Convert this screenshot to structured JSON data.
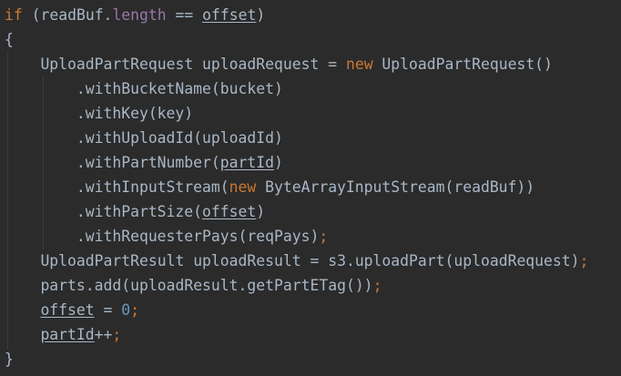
{
  "editor": {
    "language": "java",
    "theme_colors": {
      "background": "#2b2b2b",
      "default_text": "#a9b7c6",
      "keyword": "#cc7832",
      "number": "#6897bb",
      "field": "#9876aa",
      "indent_guide": "#3b3b3b"
    },
    "lines": [
      {
        "indent": 0,
        "tokens": [
          {
            "t": "if",
            "c": "kw"
          },
          {
            "t": " (readBuf."
          },
          {
            "t": "length",
            "c": "field"
          },
          {
            "t": " == "
          },
          {
            "t": "offset",
            "c": "ul"
          },
          {
            "t": ")"
          }
        ]
      },
      {
        "indent": 0,
        "tokens": [
          {
            "t": "{"
          }
        ]
      },
      {
        "indent": 4,
        "tokens": [
          {
            "t": "UploadPartRequest uploadRequest = "
          },
          {
            "t": "new",
            "c": "kw"
          },
          {
            "t": " UploadPartRequest()"
          }
        ]
      },
      {
        "indent": 8,
        "tokens": [
          {
            "t": ".withBucketName(bucket)"
          }
        ]
      },
      {
        "indent": 8,
        "tokens": [
          {
            "t": ".withKey(key)"
          }
        ]
      },
      {
        "indent": 8,
        "tokens": [
          {
            "t": ".withUploadId(uploadId)"
          }
        ]
      },
      {
        "indent": 8,
        "tokens": [
          {
            "t": ".withPartNumber("
          },
          {
            "t": "partId",
            "c": "ul"
          },
          {
            "t": ")"
          }
        ]
      },
      {
        "indent": 8,
        "tokens": [
          {
            "t": ".withInputStream("
          },
          {
            "t": "new",
            "c": "kw"
          },
          {
            "t": " ByteArrayInputStream(readBuf))"
          }
        ]
      },
      {
        "indent": 8,
        "tokens": [
          {
            "t": ".withPartSize("
          },
          {
            "t": "offset",
            "c": "ul"
          },
          {
            "t": ")"
          }
        ]
      },
      {
        "indent": 8,
        "tokens": [
          {
            "t": ".withRequesterPays(reqPays)"
          },
          {
            "t": ";",
            "c": "kw"
          }
        ]
      },
      {
        "indent": 4,
        "tokens": [
          {
            "t": "UploadPartResult uploadResult = s3.uploadPart(uploadRequest)"
          },
          {
            "t": ";",
            "c": "kw"
          }
        ]
      },
      {
        "indent": 4,
        "tokens": [
          {
            "t": "parts.add(uploadResult.getPartETag())"
          },
          {
            "t": ";",
            "c": "kw"
          }
        ]
      },
      {
        "indent": 4,
        "tokens": [
          {
            "t": "offset",
            "c": "ul"
          },
          {
            "t": " = "
          },
          {
            "t": "0",
            "c": "num"
          },
          {
            "t": ";",
            "c": "kw"
          }
        ]
      },
      {
        "indent": 4,
        "tokens": [
          {
            "t": "partId",
            "c": "ul"
          },
          {
            "t": "++"
          },
          {
            "t": ";",
            "c": "kw"
          }
        ]
      },
      {
        "indent": 0,
        "tokens": [
          {
            "t": "}"
          }
        ]
      }
    ]
  }
}
